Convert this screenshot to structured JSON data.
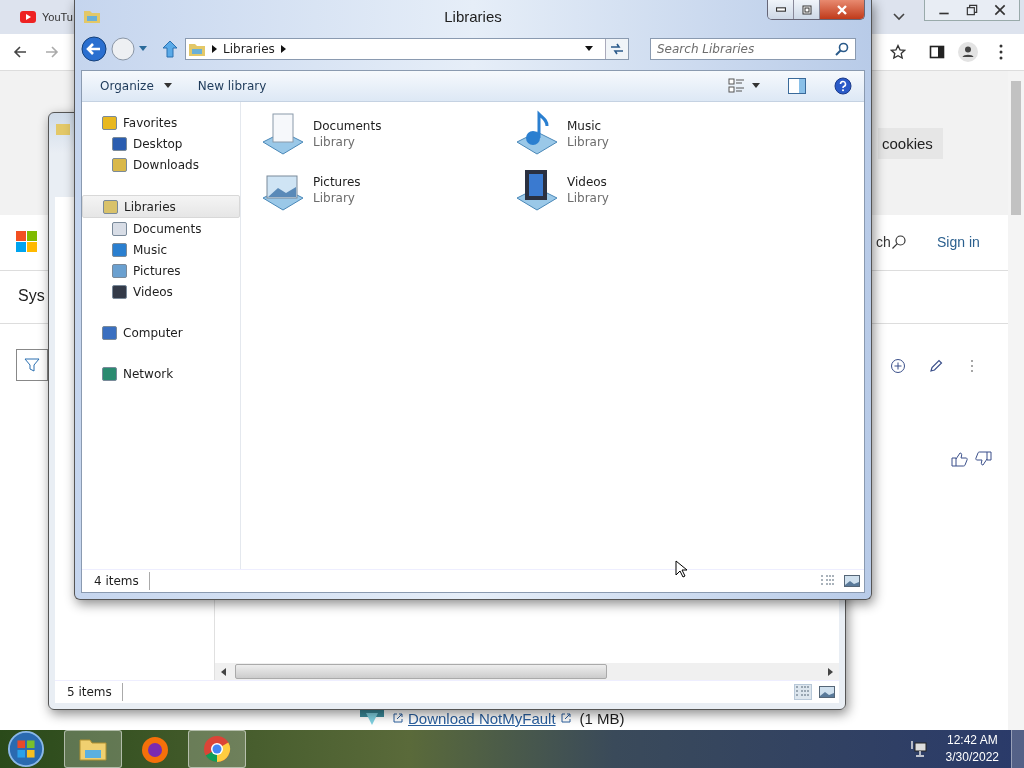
{
  "browser": {
    "tab_title": "YouTu",
    "cookies_button": "cookies",
    "search_label": "ch",
    "sign_in": "Sign in",
    "heading": "Sys",
    "download_link": "Download NotMyFault",
    "download_size": "(1 MB)"
  },
  "back_window": {
    "status": "5 items"
  },
  "window": {
    "title": "Libraries",
    "breadcrumb": [
      "Libraries"
    ],
    "search": {
      "placeholder": "Search Libraries"
    },
    "toolbar": [
      "Organize",
      "New library"
    ],
    "nav": [
      {
        "label": "Favorites",
        "kind": "star",
        "selected": false,
        "children": [
          {
            "label": "Desktop",
            "kind": "desktop",
            "selected": false
          },
          {
            "label": "Downloads",
            "kind": "downloads",
            "selected": false
          }
        ]
      },
      {
        "label": "Libraries",
        "kind": "library",
        "selected": true,
        "children": [
          {
            "label": "Documents",
            "kind": "documents",
            "selected": false
          },
          {
            "label": "Music",
            "kind": "music",
            "selected": false
          },
          {
            "label": "Pictures",
            "kind": "pictures",
            "selected": false
          },
          {
            "label": "Videos",
            "kind": "videos",
            "selected": false
          }
        ]
      },
      {
        "label": "Computer",
        "kind": "computer",
        "selected": false
      },
      {
        "label": "Network",
        "kind": "network",
        "selected": false
      }
    ],
    "items": [
      {
        "name": "Documents",
        "type": "Library",
        "kind": "documents"
      },
      {
        "name": "Music",
        "type": "Library",
        "kind": "music"
      },
      {
        "name": "Pictures",
        "type": "Library",
        "kind": "pictures"
      },
      {
        "name": "Videos",
        "type": "Library",
        "kind": "videos"
      }
    ],
    "status": "4 items"
  },
  "taskbar": {
    "apps": [
      {
        "kind": "explorer",
        "selected": true
      },
      {
        "kind": "firefox",
        "selected": false
      },
      {
        "kind": "chrome",
        "selected": true
      }
    ],
    "time": "12:42 AM",
    "date": "3/30/2022"
  }
}
